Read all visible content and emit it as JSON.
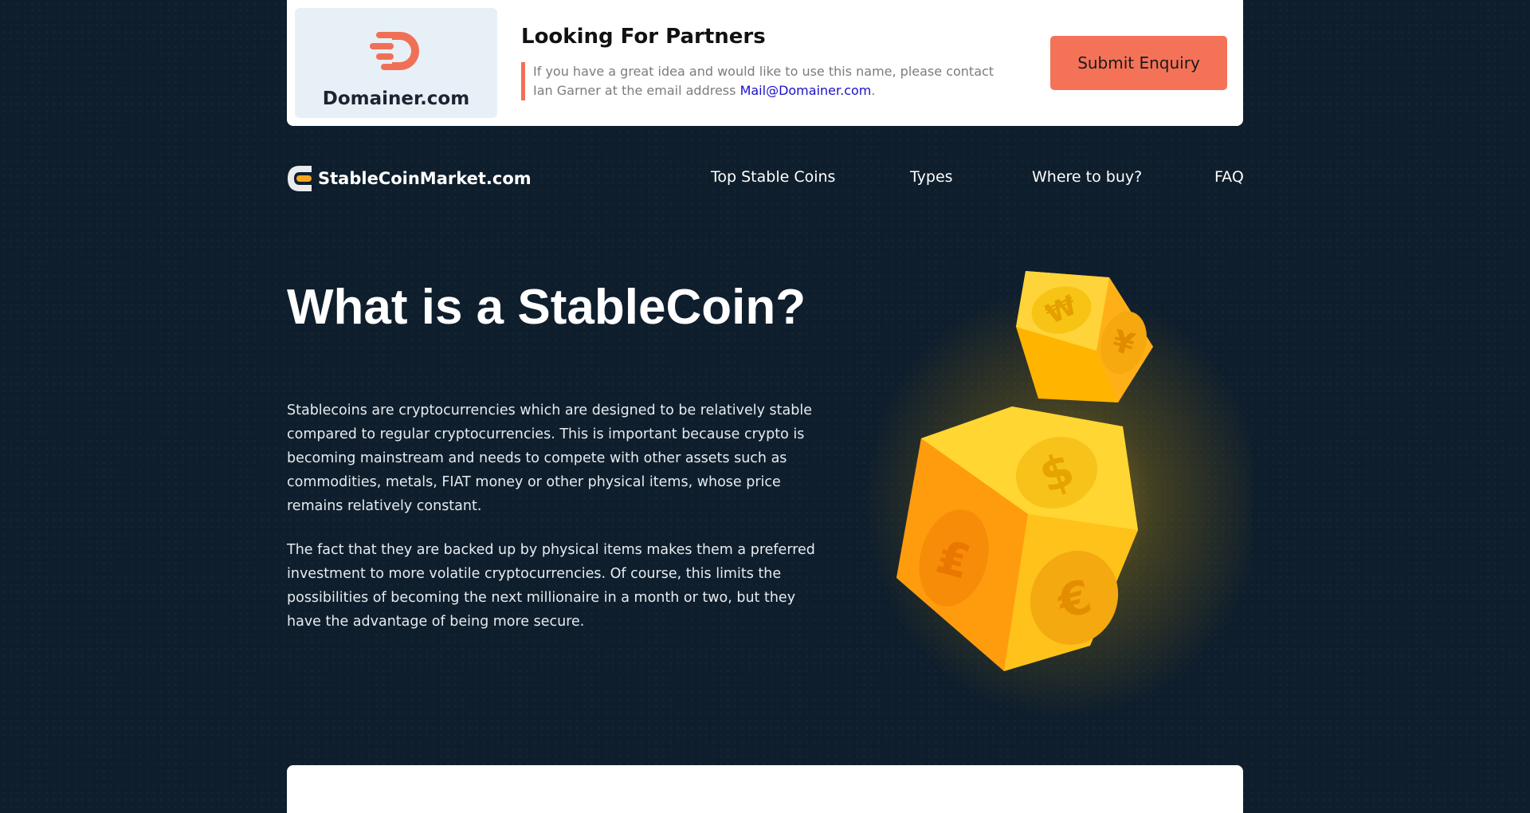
{
  "banner": {
    "brand_logo_icon": "domainer-d-logo",
    "brand_name": "Domainer.com",
    "title": "Looking For Partners",
    "desc_prefix": "If you have a great idea and would like to use this name, please contact Ian Garner at the email address ",
    "email": "Mail@Domainer.com",
    "desc_suffix": ".",
    "button_label": "Submit Enquiry",
    "accent_color": "#f47358"
  },
  "header": {
    "logo_icon": "stablecoin-c-logo",
    "logo_text": "StableCoinMarket.com",
    "nav": [
      {
        "label": "Top Stable Coins"
      },
      {
        "label": "Types"
      },
      {
        "label": "Where to buy?"
      },
      {
        "label": "FAQ"
      }
    ]
  },
  "hero": {
    "title": "What is a StableCoin?",
    "paragraphs": [
      "Stablecoins are cryptocurrencies which are designed to be relatively stable compared to regular cryptocurrencies. This is important because crypto is becoming mainstream and needs to compete with other assets such as commodities, metals, FIAT money or other physical items, whose price remains relatively constant.",
      "The fact that they are backed up by physical items makes them a preferred investment to more volatile cryptocurrencies. Of course, this limits the possibilities of becoming the next millionaire in a month or two, but they have the advantage of being more secure."
    ],
    "illustration_icon": "golden-currency-dice",
    "dice_symbols": [
      "₩",
      "¥",
      "$",
      "₤",
      "€"
    ]
  },
  "colors": {
    "background": "#0f1e2c",
    "coin_gold": "#ffc21a"
  }
}
